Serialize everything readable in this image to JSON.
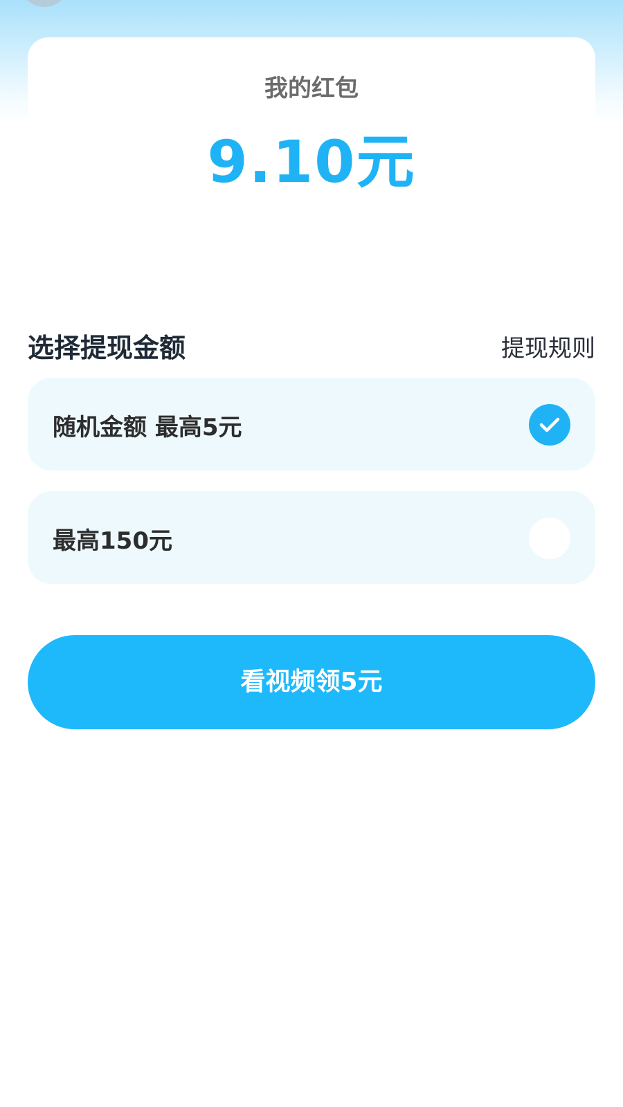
{
  "wallet": {
    "title": "我的红包",
    "amount": "9.10元"
  },
  "withdraw": {
    "section_title": "选择提现金额",
    "rules_link": "提现规则",
    "options": [
      {
        "label": "随机金额 最高5元",
        "selected": true
      },
      {
        "label": "最高150元",
        "selected": false
      }
    ]
  },
  "cta": {
    "label": "看视频领5元"
  },
  "colors": {
    "accent": "#1fb3f5",
    "button": "#1db9fb",
    "option_bg": "#eef9fe"
  },
  "icons": {
    "selected_radio": "check-circle-icon",
    "unselected_radio": "empty-circle-icon"
  }
}
